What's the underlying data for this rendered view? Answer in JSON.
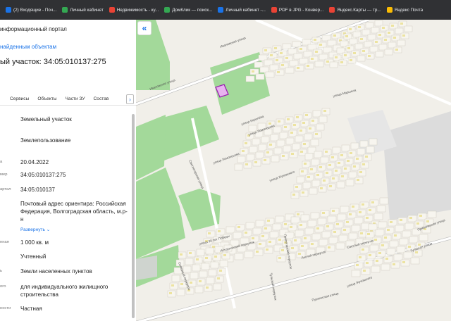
{
  "bookmarks": [
    {
      "label": "(2) Входящие - Поч...",
      "icon": "mail-icon",
      "color": "#1a73e8"
    },
    {
      "label": "Личный кабинет",
      "icon": "shield-icon",
      "color": "#34a853"
    },
    {
      "label": "Недвижимость - ку...",
      "icon": "circle-icon",
      "color": "#ea4335"
    },
    {
      "label": "ДомКлик — поиск...",
      "icon": "house-icon",
      "color": "#34a853"
    },
    {
      "label": "Личный кабинет -...",
      "icon": "swoosh-icon",
      "color": "#1a73e8"
    },
    {
      "label": "PDF в JPG - Конвер...",
      "icon": "pdf-icon",
      "color": "#ea4335"
    },
    {
      "label": "Яндекс.Карты — тр...",
      "icon": "pin-icon",
      "color": "#ea4335"
    },
    {
      "label": "Яндекс Почта",
      "icon": "envelope-icon",
      "color": "#fbbc04"
    }
  ],
  "panel": {
    "portal_title": "информационный портал",
    "back_link": "найденным объектам",
    "plot_title": "ый участок: 34:05:010137:275",
    "tabs": [
      "Сервисы",
      "Объекты",
      "Части ЗУ",
      "Состав"
    ],
    "tab_arrow": "›",
    "properties": [
      {
        "label": "",
        "value": "Земельный участок"
      },
      {
        "label": "",
        "value": "Землепользование"
      },
      {
        "label": "а",
        "value": "20.04.2022"
      },
      {
        "label": "мер",
        "value": "34:05:010137:275"
      },
      {
        "label": "артал",
        "value": "34:05:010137"
      },
      {
        "label": "",
        "value": "Почтовый адрес ориентира: Российская Федерация, Волгоградская область, м.р-н"
      },
      {
        "label": "нная",
        "value": "1 000 кв. м"
      },
      {
        "label": "",
        "value": "Учтенный"
      },
      {
        "label": "ь",
        "value": "Земли населенных пунктов"
      },
      {
        "label": "ого",
        "value": "для индивидуального жилищного строительства"
      },
      {
        "label": "ности",
        "value": "Частная"
      }
    ],
    "expand_label": "Развернуть"
  },
  "map": {
    "collapse_label": "«",
    "streets": [
      "Ивановская улица",
      "Ивановская улица",
      "улица Королёва",
      "улица Ломоносова",
      "улица Ломоносова",
      "Светлогорская улица",
      "улица Жуковского",
      "улица Маршала",
      "улица 30 лет Победы",
      "Исторический переулок",
      "Пролетарский переулок",
      "Тульский переулок",
      "Лесной переулок",
      "Светлый переулок",
      "Тульская улица",
      "Приволжская улица",
      "Пушкинская улица",
      "улица Жуковского",
      "Северный переулок"
    ]
  }
}
